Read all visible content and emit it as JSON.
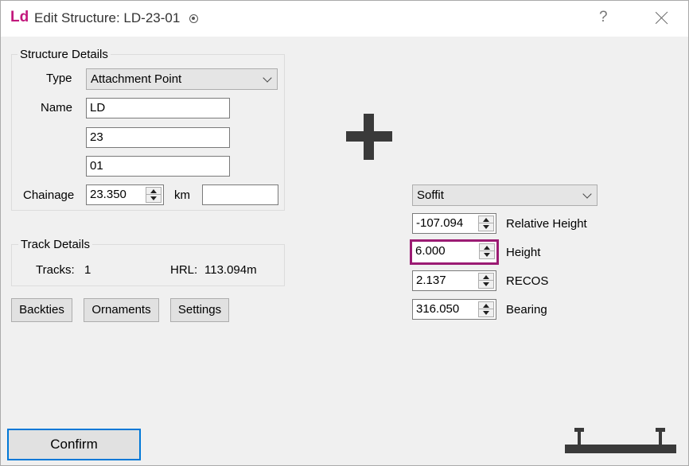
{
  "window": {
    "logo_text": "Ld",
    "title": "Edit Structure: LD-23-01",
    "help_label": "?",
    "brand_color": "#c2187c"
  },
  "structure_details": {
    "legend": "Structure Details",
    "type_label": "Type",
    "type_value": "Attachment Point",
    "name_label": "Name",
    "name_part1": "LD",
    "name_part2": "23",
    "name_part3": "01",
    "chainage_label": "Chainage",
    "chainage_value": "23.350",
    "chainage_unit": "km",
    "chainage_extra": ""
  },
  "track_details": {
    "legend": "Track Details",
    "tracks_label": "Tracks:",
    "tracks_value": "1",
    "hrl_label": "HRL:",
    "hrl_value": "113.094m"
  },
  "buttons": {
    "backties": "Backties",
    "ornaments": "Ornaments",
    "settings": "Settings",
    "confirm": "Confirm"
  },
  "position": {
    "reference_value": "Soffit",
    "relative_height_value": "-107.094",
    "relative_height_label": "Relative Height",
    "height_value": "6.000",
    "height_label": "Height",
    "recos_value": "2.137",
    "recos_label": "RECOS",
    "bearing_value": "316.050",
    "bearing_label": "Bearing",
    "focus_color": "#9b1b73"
  },
  "icons": {
    "add": "plus-icon",
    "structure": "gantry-structure-icon"
  }
}
